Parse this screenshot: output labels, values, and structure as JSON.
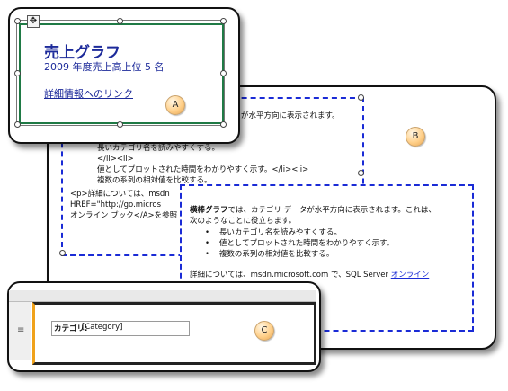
{
  "panel_a": {
    "title": "売上グラフ",
    "subtitle": "2009 年度売上高上位 5 名",
    "link": "詳細情報へのリンク",
    "callout": "A"
  },
  "panel_b": {
    "callout": "B",
    "html_lines": [
      "が水平方向に表示されます。",
      "長いカテゴリ名を読みやすくする。",
      "</li><li>",
      "値としてプロットされた時間をわかりやすく示す。</li><li>",
      "複数の系列の相対値を比較する。",
      "<p>詳細については、msdn",
      "HREF=\"http://go.micros",
      "オンライン ブック</A>を参照"
    ],
    "rendered": {
      "lead_bold": "横棒グラフ",
      "line1_rest": "では、カテゴリ データが水平方向に表示されます。これは、",
      "line2": "次のようなことに役立ちます。",
      "bullets": [
        "長いカテゴリ名を読みやすくする。",
        "値としてプロットされた時間をわかりやすく示す。",
        "複数の系列の相対値を比較する。"
      ],
      "detail_text": "詳細については、msdn.microsoft.com で、SQL Server ",
      "detail_link": "オンライン"
    }
  },
  "panel_c": {
    "callout": "C",
    "field_label": "カテゴリ:",
    "field_value": "[Category]"
  }
}
